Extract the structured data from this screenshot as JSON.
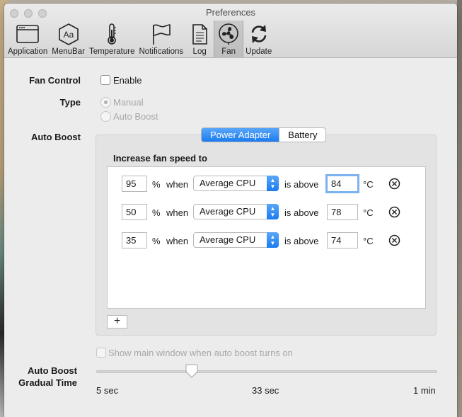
{
  "window": {
    "title": "Preferences"
  },
  "toolbar": {
    "items": [
      {
        "label": "Application",
        "icon": "application-window-icon"
      },
      {
        "label": "MenuBar",
        "icon": "menubar-text-icon"
      },
      {
        "label": "Temperature",
        "icon": "thermometer-icon"
      },
      {
        "label": "Notifications",
        "icon": "flag-icon"
      },
      {
        "label": "Log",
        "icon": "document-icon"
      },
      {
        "label": "Fan",
        "icon": "fan-icon"
      },
      {
        "label": "Update",
        "icon": "refresh-icon"
      }
    ],
    "selected": "Fan"
  },
  "fan_control": {
    "label": "Fan Control",
    "checkbox_label": "Enable",
    "checked": false
  },
  "type": {
    "label": "Type",
    "options": [
      "Manual",
      "Auto Boost"
    ],
    "selected": "Manual"
  },
  "auto_boost": {
    "label": "Auto Boost",
    "tabs": [
      "Power Adapter",
      "Battery"
    ],
    "selected_tab": "Power Adapter",
    "heading": "Increase fan speed to",
    "rules": [
      {
        "speed": "95",
        "unit": "%",
        "when": "when",
        "source": "Average CPU",
        "cond": "is above",
        "temp": "84",
        "temp_unit": "°C"
      },
      {
        "speed": "50",
        "unit": "%",
        "when": "when",
        "source": "Average CPU",
        "cond": "is above",
        "temp": "78",
        "temp_unit": "°C"
      },
      {
        "speed": "35",
        "unit": "%",
        "when": "when",
        "source": "Average CPU",
        "cond": "is above",
        "temp": "74",
        "temp_unit": "°C"
      }
    ],
    "add_label": "+"
  },
  "show_main": {
    "label": "Show main window when auto boost turns on",
    "checked": false
  },
  "gradual": {
    "label_line1": "Auto Boost",
    "label_line2": "Gradual Time",
    "ticks": [
      "5 sec",
      "33 sec",
      "1 min"
    ],
    "value_fraction": 0.28
  },
  "colors": {
    "accent": "#1b7cf0",
    "window_bg": "#ececec"
  }
}
